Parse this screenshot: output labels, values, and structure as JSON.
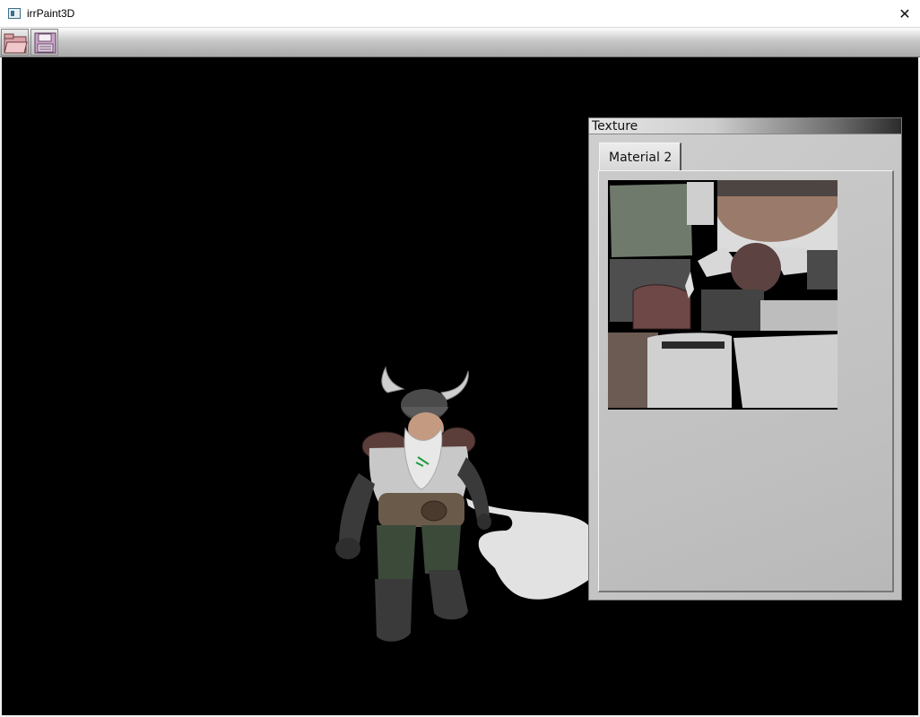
{
  "window": {
    "title": "irrPaint3D",
    "close_glyph": "✕",
    "icon": "app-window-icon"
  },
  "toolbar": {
    "buttons": [
      {
        "name": "open",
        "icon": "folder-open-icon"
      },
      {
        "name": "save",
        "icon": "floppy-disk-icon"
      }
    ]
  },
  "viewport": {
    "background": "#000000",
    "model": "dwarf-character"
  },
  "texture_window": {
    "title": "Texture",
    "tabs": [
      {
        "label": "Material 2",
        "selected": true
      }
    ],
    "content": "dwarf-texture-atlas"
  }
}
